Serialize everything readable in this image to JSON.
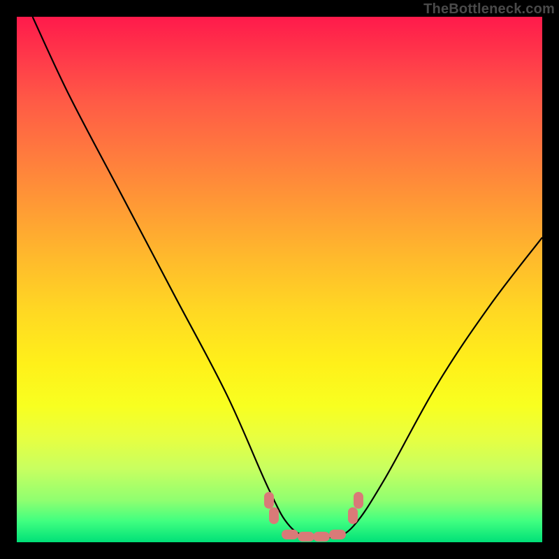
{
  "attribution": "TheBottleneck.com",
  "colors": {
    "frame": "#000000",
    "curve": "#000000",
    "marker": "#d97a78",
    "gradient_top": "#ff1a4b",
    "gradient_bottom": "#00e078"
  },
  "chart_data": {
    "type": "line",
    "title": "",
    "xlabel": "",
    "ylabel": "",
    "xlim": [
      0,
      100
    ],
    "ylim": [
      0,
      100
    ],
    "grid": false,
    "series": [
      {
        "name": "bottleneck-curve",
        "x": [
          3,
          10,
          20,
          30,
          40,
          48,
          52,
          56,
          60,
          64,
          70,
          80,
          90,
          100
        ],
        "values": [
          100,
          85,
          66,
          47,
          28,
          10,
          3,
          1,
          1,
          3,
          12,
          30,
          45,
          58
        ]
      }
    ],
    "annotations": [
      {
        "name": "left-marker-upper",
        "x": 48,
        "y": 8,
        "shape": "vert"
      },
      {
        "name": "left-marker-lower",
        "x": 49,
        "y": 5,
        "shape": "vert"
      },
      {
        "name": "valley-marker-1",
        "x": 52,
        "y": 1.5,
        "shape": "horiz"
      },
      {
        "name": "valley-marker-2",
        "x": 55,
        "y": 1,
        "shape": "horiz"
      },
      {
        "name": "valley-marker-3",
        "x": 58,
        "y": 1,
        "shape": "horiz"
      },
      {
        "name": "valley-marker-4",
        "x": 61,
        "y": 1.5,
        "shape": "horiz"
      },
      {
        "name": "right-marker-lower",
        "x": 64,
        "y": 5,
        "shape": "vert"
      },
      {
        "name": "right-marker-upper",
        "x": 65,
        "y": 8,
        "shape": "vert"
      }
    ]
  }
}
